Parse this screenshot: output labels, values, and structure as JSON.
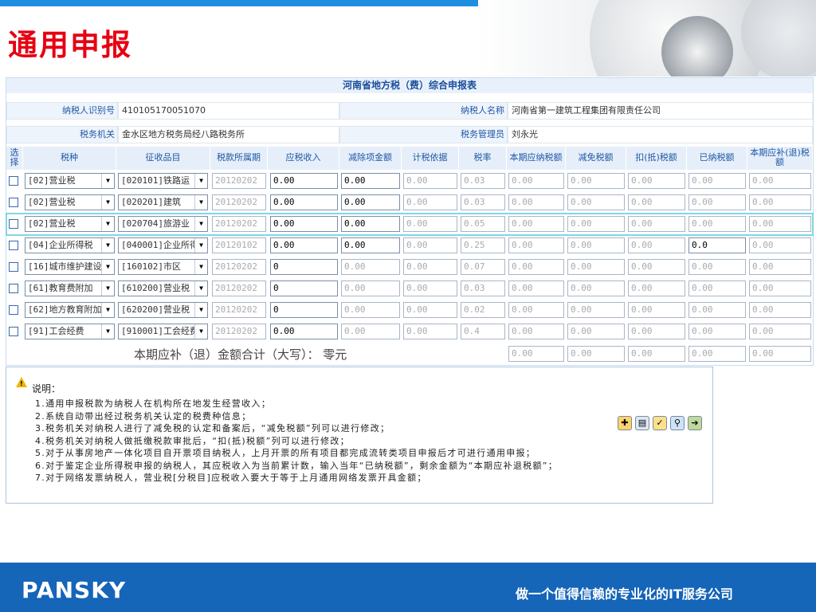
{
  "title": "通用申报",
  "form": {
    "title": "河南省地方税（费）综合申报表",
    "taxpayer_id_label": "纳税人识别号",
    "taxpayer_id": "410105170051070",
    "taxpayer_name_label": "纳税人名称",
    "taxpayer_name": "河南省第一建筑工程集团有限责任公司",
    "tax_office_label": "税务机关",
    "tax_office": "金水区地方税务局经八路税务所",
    "tax_manager_label": "税务管理员",
    "tax_manager": "刘永光",
    "headers": [
      "选择",
      "税种",
      "征收品目",
      "税款所属期",
      "应税收入",
      "减除项金额",
      "计税依据",
      "税率",
      "本期应纳税额",
      "减免税额",
      "扣(抵)税额",
      "已纳税额",
      "本期应补(退)税额"
    ],
    "rows": [
      {
        "tax": "[02]营业税",
        "item": "[020101]铁路运",
        "period": "20120202",
        "income": "0.00",
        "deduct": "0.00",
        "basis": "0.00",
        "rate": "0.03",
        "payable": "0.00",
        "relief": "0.00",
        "credit": "0.00",
        "paid": "0.00",
        "due": "0.00"
      },
      {
        "tax": "[02]营业税",
        "item": "[020201]建筑",
        "period": "20120202",
        "income": "0.00",
        "deduct": "0.00",
        "basis": "0.00",
        "rate": "0.03",
        "payable": "0.00",
        "relief": "0.00",
        "credit": "0.00",
        "paid": "0.00",
        "due": "0.00"
      },
      {
        "tax": "[02]营业税",
        "item": "[020704]旅游业",
        "period": "20120202",
        "income": "0.00",
        "deduct": "0.00",
        "basis": "0.00",
        "rate": "0.05",
        "payable": "0.00",
        "relief": "0.00",
        "credit": "0.00",
        "paid": "0.00",
        "due": "0.00"
      },
      {
        "tax": "[04]企业所得税",
        "item": "[040001]企业所得",
        "period": "20120102",
        "income": "0.00",
        "deduct": "0.00",
        "basis": "0.00",
        "rate": "0.25",
        "payable": "0.00",
        "relief": "0.00",
        "credit": "0.00",
        "paid": "0.0",
        "due": "0.00"
      },
      {
        "tax": "[16]城市维护建设",
        "item": "[160102]市区",
        "period": "20120202",
        "income": "0",
        "deduct": "0.00",
        "basis": "0.00",
        "rate": "0.07",
        "payable": "0.00",
        "relief": "0.00",
        "credit": "0.00",
        "paid": "0.00",
        "due": "0.00"
      },
      {
        "tax": "[61]教育费附加",
        "item": "[610200]营业税",
        "period": "20120202",
        "income": "0",
        "deduct": "0.00",
        "basis": "0.00",
        "rate": "0.03",
        "payable": "0.00",
        "relief": "0.00",
        "credit": "0.00",
        "paid": "0.00",
        "due": "0.00"
      },
      {
        "tax": "[62]地方教育附加",
        "item": "[620200]营业税",
        "period": "20120202",
        "income": "0",
        "deduct": "0.00",
        "basis": "0.00",
        "rate": "0.02",
        "payable": "0.00",
        "relief": "0.00",
        "credit": "0.00",
        "paid": "0.00",
        "due": "0.00"
      },
      {
        "tax": "[91]工会经费",
        "item": "[910001]工会经费",
        "period": "20120202",
        "income": "0.00",
        "deduct": "0.00",
        "basis": "0.00",
        "rate": "0.4",
        "payable": "0.00",
        "relief": "0.00",
        "credit": "0.00",
        "paid": "0.00",
        "due": "0.00"
      }
    ],
    "total_label": "本期应补（退）金额合计（大写）：  零元",
    "totals": [
      "0.00",
      "0.00",
      "0.00",
      "0.00",
      "0.00"
    ]
  },
  "note": {
    "heading": "说明：",
    "lines": [
      "1.通用申报税款为纳税人在机构所在地发生经营收入；",
      "2.系统自动带出经过税务机关认定的税费种信息；",
      "3.税务机关对纳税人进行了减免税的认定和备案后，“减免税额”列可以进行修改；",
      "4.税务机关对纳税人做抵缴税款审批后，“扣(抵)税额”列可以进行修改；",
      "5.对于从事房地产一体化项目自开票项目纳税人，上月开票的所有项目都完成流转类项目申报后才可进行通用申报；",
      "6.对于鉴定企业所得税申报的纳税人，其应税收入为当前累计数，输入当年“已纳税额”，剩余金额为“本期应补退税额”；",
      "7.对于网络发票纳税人，营业税[分税目]应税收入要大于等于上月通用网络发票开具金额；"
    ]
  },
  "footer": {
    "logo": "PANSKY",
    "slogan": "做一个值得信赖的专业化的IT服务公司"
  }
}
